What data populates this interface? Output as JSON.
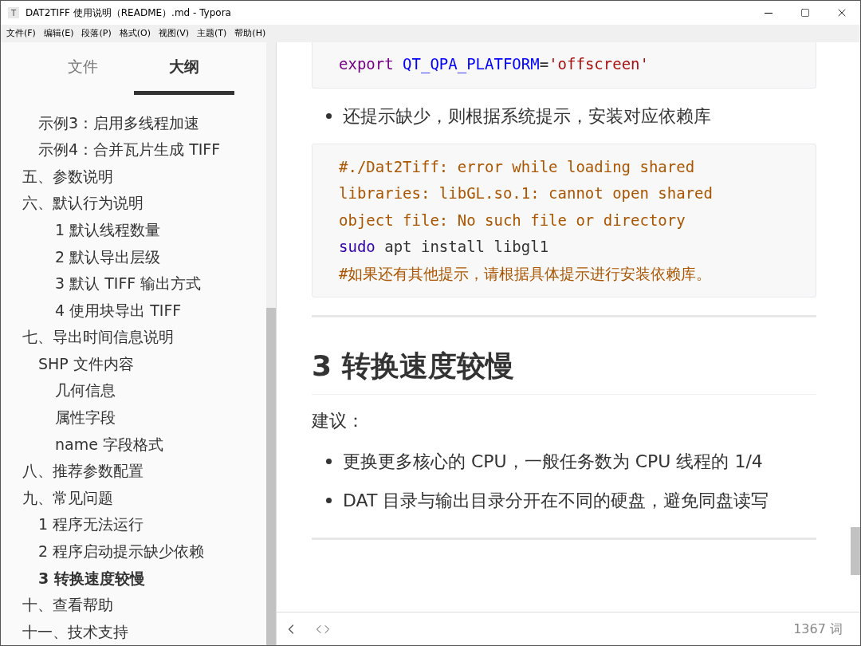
{
  "window": {
    "icon_text": "T",
    "title": "DAT2TIFF 使用说明（README）.md - Typora"
  },
  "menu": [
    "文件(F)",
    "编辑(E)",
    "段落(P)",
    "格式(O)",
    "视图(V)",
    "主题(T)",
    "帮助(H)"
  ],
  "sidebar": {
    "tabs": [
      {
        "label": "文件",
        "selected": false
      },
      {
        "label": "大纲",
        "selected": true
      }
    ],
    "outline": [
      {
        "children": [
          {
            "label": "示例3：启用多线程加速",
            "selected": false
          },
          {
            "label": "示例4：合并瓦片生成 TIFF",
            "selected": false
          }
        ]
      },
      {
        "label": "五、参数说明",
        "selected": false
      },
      {
        "label": "六、默认行为说明",
        "selected": false,
        "children": [
          {
            "children": [
              {
                "label": "1 默认线程数量",
                "selected": false
              },
              {
                "label": "2 默认导出层级",
                "selected": false
              },
              {
                "label": "3 默认 TIFF 输出方式",
                "selected": false
              },
              {
                "label": "4 使用块导出 TIFF",
                "selected": false
              }
            ]
          }
        ]
      },
      {
        "label": "七、导出时间信息说明",
        "selected": false,
        "children": [
          {
            "label": "SHP 文件内容",
            "selected": false,
            "children": [
              {
                "label": "几何信息",
                "selected": false
              },
              {
                "label": "属性字段",
                "selected": false
              },
              {
                "label": "name 字段格式",
                "selected": false
              }
            ]
          }
        ]
      },
      {
        "label": "八、推荐参数配置",
        "selected": false
      },
      {
        "label": "九、常见问题",
        "selected": false,
        "children": [
          {
            "label": "1 程序无法运行",
            "selected": false
          },
          {
            "label": "2 程序启动提示缺少依赖",
            "selected": false
          },
          {
            "label": "3 转换速度较慢",
            "selected": true
          }
        ]
      },
      {
        "label": "十、查看帮助",
        "selected": false
      },
      {
        "label": "十一、技术支持",
        "selected": false
      }
    ]
  },
  "content": [
    {
      "kind": "code",
      "clipped": true,
      "lines": [
        [
          {
            "kind": "keyword",
            "text": "export "
          },
          {
            "kind": "variable",
            "text": "QT_QPA_PLATFORM"
          },
          {
            "kind": "plain",
            "text": "="
          },
          {
            "kind": "string",
            "text": "'offscreen'"
          }
        ]
      ]
    },
    {
      "kind": "bullets",
      "items": [
        "还提示缺少，则根据系统提示，安装对应依赖库"
      ]
    },
    {
      "kind": "code",
      "clipped": false,
      "lines": [
        [
          {
            "kind": "comment",
            "text": "#./Dat2Tiff: error while loading shared"
          }
        ],
        [
          {
            "kind": "comment",
            "text": "libraries: libGL.so.1: cannot open shared"
          }
        ],
        [
          {
            "kind": "comment",
            "text": "object file: No such file or directory"
          }
        ],
        [
          {
            "kind": "builtin",
            "text": "sudo"
          },
          {
            "kind": "plain",
            "text": " apt install libgl1"
          }
        ],
        [
          {
            "kind": "comment",
            "text": "#如果还有其他提示，请根据具体提示进行安装依赖库。"
          }
        ]
      ]
    },
    {
      "kind": "rule"
    },
    {
      "kind": "heading",
      "text": "3 转换速度较慢"
    },
    {
      "kind": "paragraph",
      "text": "建议："
    },
    {
      "kind": "bullets",
      "items": [
        "更换更多核心的 CPU，一般任务数为 CPU 线程的 1/4",
        "DAT 目录与输出目录分开在不同的硬盘，避免同盘读写"
      ]
    },
    {
      "kind": "rule"
    }
  ],
  "status_bar": {
    "word_count": "1367 词"
  }
}
